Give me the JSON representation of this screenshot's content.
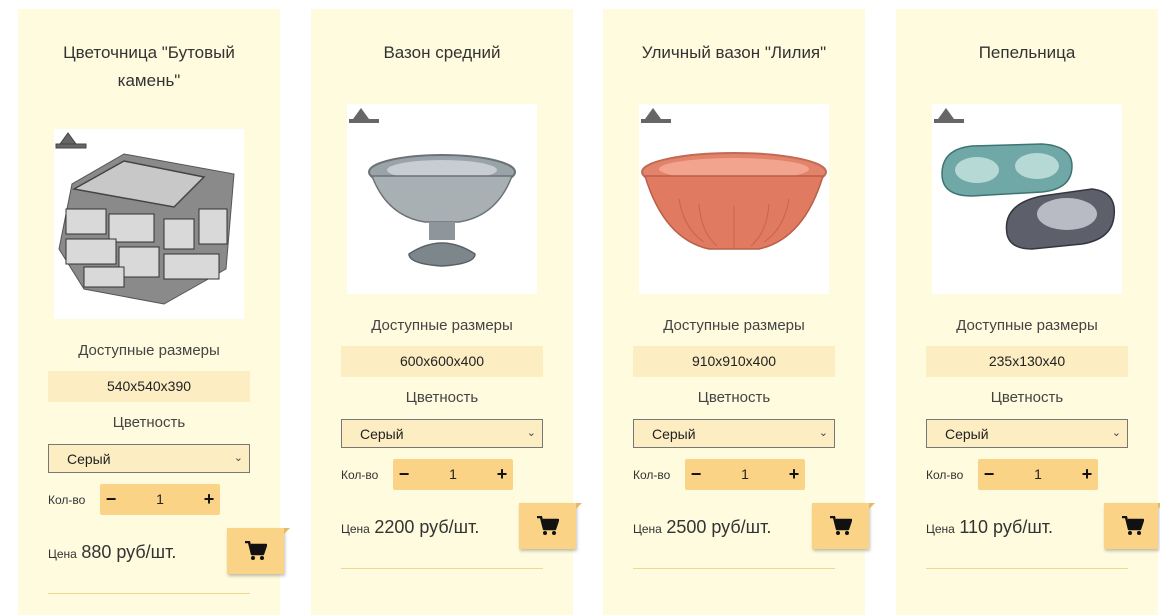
{
  "labels": {
    "sizes": "Доступные размеры",
    "color": "Цветность",
    "qty": "Кол-во",
    "price": "Цена"
  },
  "products": [
    {
      "title": "Цветочница \"Бутовый камень\"",
      "size": "540x540x390",
      "color": "Серый",
      "qty": "1",
      "price": "880 руб/шт.",
      "image": "stone-planter"
    },
    {
      "title": "Вазон средний",
      "size": "600x600x400",
      "color": "Серый",
      "qty": "1",
      "price": "2200 руб/шт.",
      "image": "grey-vase"
    },
    {
      "title": "Уличный вазон \"Лилия\"",
      "size": "910x910x400",
      "color": "Серый",
      "qty": "1",
      "price": "2500 руб/шт.",
      "image": "terracotta-vase"
    },
    {
      "title": "Пепельница",
      "size": "235x130x40",
      "color": "Серый",
      "qty": "1",
      "price": "110 руб/шт.",
      "image": "ashtrays"
    }
  ],
  "colors": {
    "card_bg": "#fefbde",
    "accent": "#fbd387",
    "size_bg": "#fdedc3"
  },
  "icons": {
    "cart": "cart-icon",
    "minus": "minus-icon",
    "plus": "plus-icon",
    "select": "chevron-down-icon"
  }
}
